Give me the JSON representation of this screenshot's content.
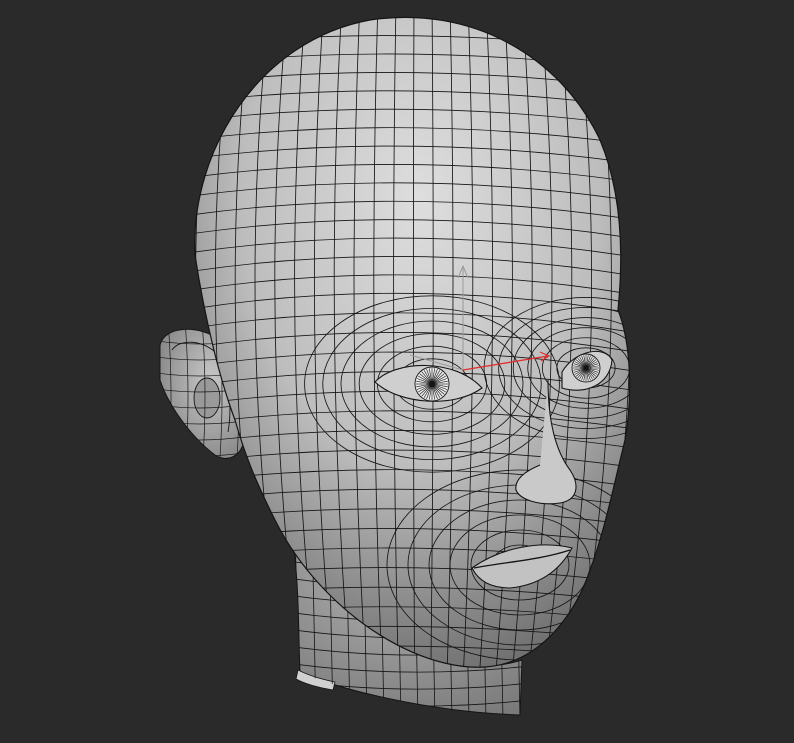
{
  "viewport": {
    "background": "#2a2a2a",
    "mesh_fill_light": "#d8d8d8",
    "mesh_fill_dark": "#6a6a6a",
    "wire_color": "#151515",
    "axis_color": "#9a9a9a",
    "selection_color": "#e03030"
  },
  "model": {
    "icons": [
      "head-mesh-icon",
      "transform-gizmo-icon"
    ]
  }
}
